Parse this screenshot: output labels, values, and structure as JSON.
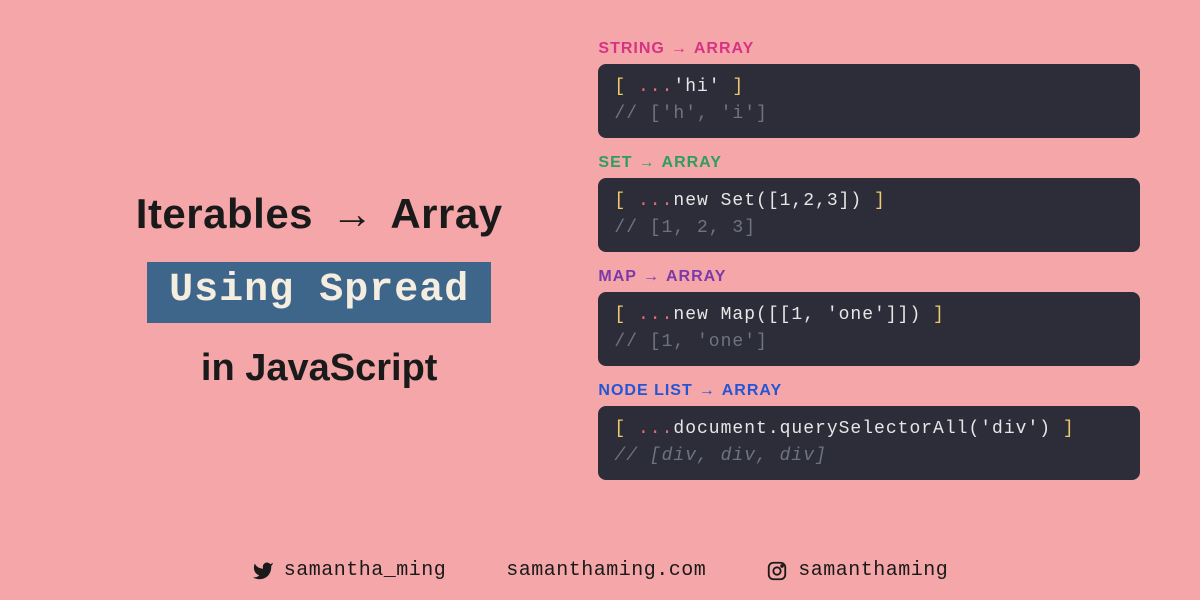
{
  "title": {
    "line1_left": "Iterables",
    "line1_right": "Array",
    "line2": "Using Spread",
    "line3": "in JavaScript"
  },
  "header_suffix": "ARRAY",
  "blocks": [
    {
      "header_label": "STRING",
      "header_class": "header-pink",
      "code_text": "'hi'",
      "comment": "['h', 'i']"
    },
    {
      "header_label": "SET",
      "header_class": "header-green",
      "code_text": "new Set([1,2,3])",
      "comment": "[1, 2, 3]"
    },
    {
      "header_label": "MAP",
      "header_class": "header-purple",
      "code_text": "new Map([[1, 'one']])",
      "comment": "[1, 'one']"
    },
    {
      "header_label": "NODE LIST",
      "header_class": "header-blue",
      "code_text": "document.querySelectorAll('div')",
      "comment": "[div, div, div]",
      "comment_italic": true
    }
  ],
  "footer": {
    "twitter": "samantha_ming",
    "website": "samanthaming.com",
    "instagram": "samanthaming"
  }
}
